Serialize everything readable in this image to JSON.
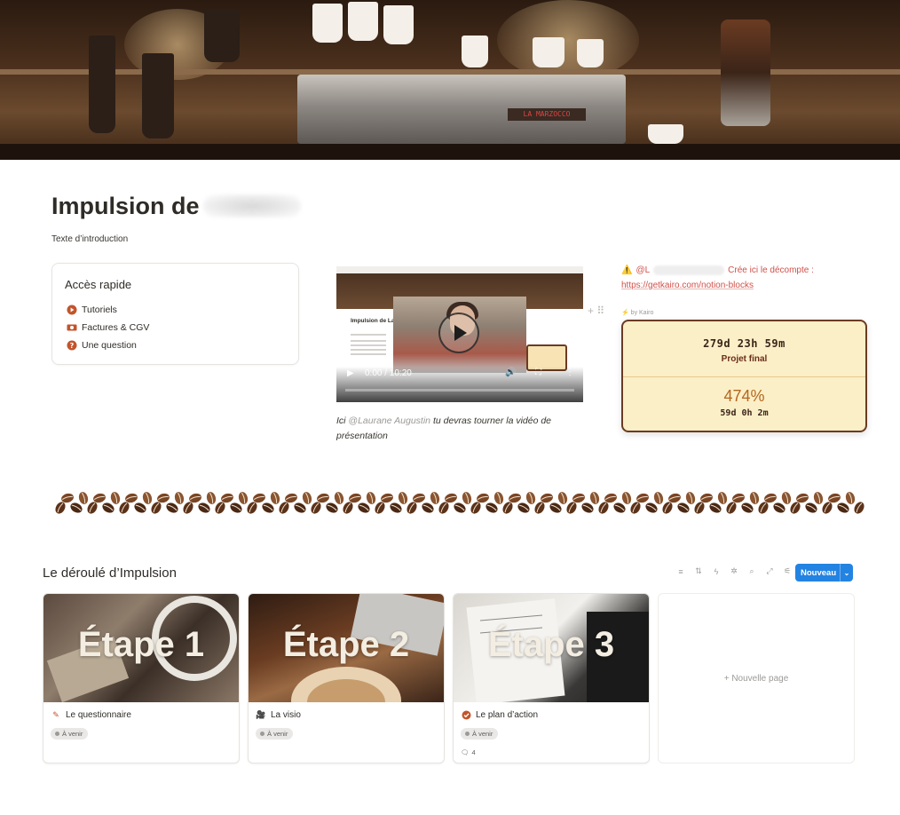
{
  "page": {
    "title": "Impulsion de",
    "intro": "Texte d’introduction"
  },
  "quick_access": {
    "title": "Accès rapide",
    "items": [
      {
        "label": "Tutoriels",
        "icon": "play-circle-icon",
        "color": "#c2542c"
      },
      {
        "label": "Factures & CGV",
        "icon": "money-icon",
        "color": "#c2542c"
      },
      {
        "label": "Une question",
        "icon": "question-circle-icon",
        "color": "#c2542c"
      }
    ]
  },
  "video": {
    "time": "0:00 / 10:20",
    "thumbnail_title": "Impulsion de La",
    "caption_prefix": "Ici",
    "caption_mention": "@Laurane Augustin",
    "caption_suffix": "tu devras tourner la vidéo de présentation"
  },
  "callout": {
    "warning_icon": "⚠️",
    "mention_prefix": "@L",
    "text": "Crée ici le décompte :",
    "link": "https://getkairo.com/notion-blocks"
  },
  "countdown": {
    "by": "by Kairo",
    "time_left": "279d 23h 59m",
    "label": "Projet final",
    "percent": "474%",
    "remaining": "59d 0h 2m"
  },
  "database": {
    "title": "Le déroulé d’Impulsion",
    "new_button": "Nouveau",
    "tools": [
      "filter-icon",
      "sort-icon",
      "automation-icon",
      "ai-icon",
      "search-icon",
      "expand-icon",
      "settings-icon"
    ],
    "new_page": "+ Nouvelle page",
    "cards": [
      {
        "image_text": "Étape 1",
        "name": "Le questionnaire",
        "icon": "edit-icon",
        "status": "À venir",
        "comments": ""
      },
      {
        "image_text": "Étape 2",
        "name": "La visio",
        "icon": "video-camera-icon",
        "status": "À venir",
        "comments": ""
      },
      {
        "image_text": "Étape 3",
        "name": "Le plan d’action",
        "icon": "check-circle-icon",
        "status": "À venir",
        "comments": "4"
      }
    ]
  },
  "colors": {
    "accent_blue": "#2383e2",
    "link_red": "#d0514a",
    "countdown_bg": "#fbefc7",
    "countdown_border": "#6b3b22"
  }
}
